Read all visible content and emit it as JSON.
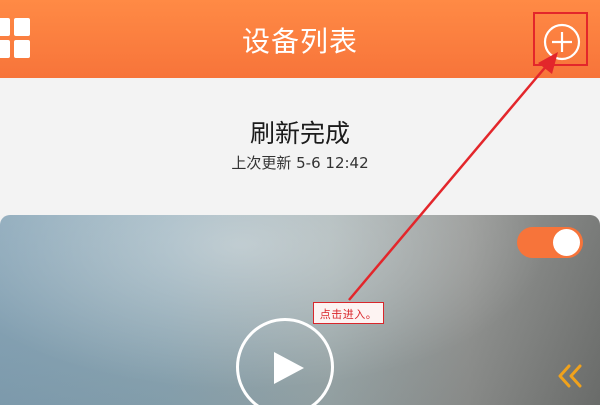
{
  "header": {
    "title": "设备列表",
    "menu_icon": "grid-icon",
    "add_icon": "add-circle-icon"
  },
  "refresh": {
    "status": "刷新完成",
    "last_update": "上次更新 5-6 12:42"
  },
  "device_card": {
    "toggle_on": true,
    "play_icon": "play-icon",
    "collapse_icon": "double-chevron-left-icon"
  },
  "annotation": {
    "label": "点击进入。"
  },
  "colors": {
    "accent": "#f7743a",
    "annotation_red": "#e3262b",
    "toggle_on": "#f7743a",
    "collapse_icon": "#f0a21c"
  }
}
